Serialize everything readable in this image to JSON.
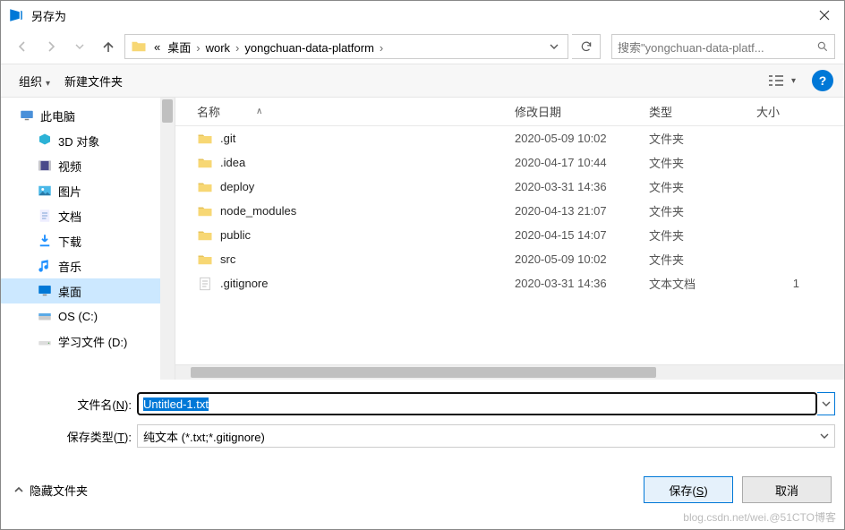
{
  "window": {
    "title": "另存为"
  },
  "breadcrumb": {
    "prefix": "«",
    "items": [
      "桌面",
      "work",
      "yongchuan-data-platform"
    ]
  },
  "search": {
    "placeholder": "搜索\"yongchuan-data-platf..."
  },
  "toolbar": {
    "organize": "组织",
    "newfolder": "新建文件夹"
  },
  "sidebar": {
    "items": [
      {
        "label": "此电脑",
        "iconcolor": "#5aa9e6",
        "indent": false,
        "selected": false,
        "type": "pc"
      },
      {
        "label": "3D 对象",
        "iconcolor": "#2cb2d6",
        "indent": true,
        "selected": false,
        "type": "3d"
      },
      {
        "label": "视频",
        "iconcolor": "#7a4cc1",
        "indent": true,
        "selected": false,
        "type": "video"
      },
      {
        "label": "图片",
        "iconcolor": "#3aa8d8",
        "indent": true,
        "selected": false,
        "type": "pic"
      },
      {
        "label": "文档",
        "iconcolor": "#4a8ac9",
        "indent": true,
        "selected": false,
        "type": "doc"
      },
      {
        "label": "下载",
        "iconcolor": "#1e90ff",
        "indent": true,
        "selected": false,
        "type": "down"
      },
      {
        "label": "音乐",
        "iconcolor": "#1e90ff",
        "indent": true,
        "selected": false,
        "type": "music"
      },
      {
        "label": "桌面",
        "iconcolor": "#0078d7",
        "indent": true,
        "selected": true,
        "type": "desk"
      },
      {
        "label": "OS (C:)",
        "iconcolor": "#5aa9e6",
        "indent": true,
        "selected": false,
        "type": "drive"
      },
      {
        "label": "学习文件 (D:)",
        "iconcolor": "#888",
        "indent": true,
        "selected": false,
        "type": "drive2"
      }
    ]
  },
  "columns": {
    "name": "名称",
    "date": "修改日期",
    "type": "类型",
    "size": "大小"
  },
  "files": [
    {
      "name": ".git",
      "date": "2020-05-09 10:02",
      "type": "文件夹",
      "size": "",
      "kind": "folder"
    },
    {
      "name": ".idea",
      "date": "2020-04-17 10:44",
      "type": "文件夹",
      "size": "",
      "kind": "folder"
    },
    {
      "name": "deploy",
      "date": "2020-03-31 14:36",
      "type": "文件夹",
      "size": "",
      "kind": "folder"
    },
    {
      "name": "node_modules",
      "date": "2020-04-13 21:07",
      "type": "文件夹",
      "size": "",
      "kind": "folder"
    },
    {
      "name": "public",
      "date": "2020-04-15 14:07",
      "type": "文件夹",
      "size": "",
      "kind": "folder"
    },
    {
      "name": "src",
      "date": "2020-05-09 10:02",
      "type": "文件夹",
      "size": "",
      "kind": "folder"
    },
    {
      "name": ".gitignore",
      "date": "2020-03-31 14:36",
      "type": "文本文档",
      "size": "1",
      "kind": "file"
    }
  ],
  "form": {
    "filename_label": "文件名(N):",
    "filename_value": "Untitled-1.txt",
    "filetype_label": "保存类型(T):",
    "filetype_value": "纯文本 (*.txt;*.gitignore)"
  },
  "footer": {
    "hide_folders": "隐藏文件夹",
    "save": "保存(S)",
    "cancel": "取消"
  },
  "watermark": "blog.csdn.net/wei.@51CTO博客"
}
